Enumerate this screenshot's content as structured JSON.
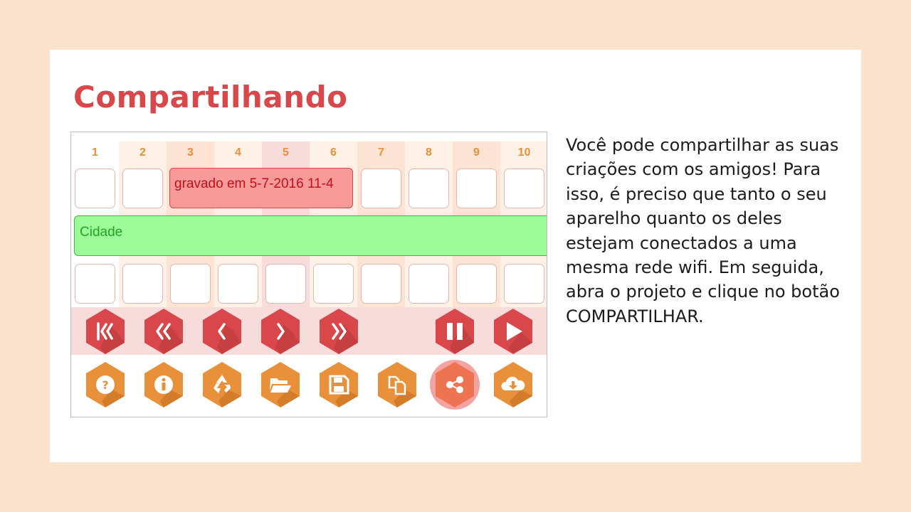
{
  "title": "Compartilhando",
  "paragraph_lines": [
    "Você pode compartilhar as suas",
    "criações com os amigos! Para",
    "isso, é preciso que tanto o seu",
    "aparelho quanto os deles",
    "estejam conectados a uma",
    "mesma rede wifi. Em seguida,",
    "abra o projeto e clique no botão",
    "COMPARTILHAR."
  ],
  "app": {
    "columns": [
      "1",
      "2",
      "3",
      "4",
      "5",
      "6",
      "7",
      "8",
      "9",
      "10"
    ],
    "pink_block_label": "gravado em 5-7-2016 11-4",
    "green_block_label": "Cidade",
    "playback_buttons": [
      "skip-to-start-icon",
      "rewind-icon",
      "step-back-icon",
      "step-forward-icon",
      "fast-forward-icon",
      "pause-icon",
      "play-icon"
    ],
    "tool_buttons": [
      "help-icon",
      "info-icon",
      "recycle-icon",
      "open-folder-icon",
      "save-icon",
      "copy-icon",
      "share-icon",
      "cloud-download-icon"
    ]
  },
  "colors": {
    "accent_red": "#d9474a",
    "accent_orange": "#e8913a",
    "background": "#fae3cc"
  }
}
